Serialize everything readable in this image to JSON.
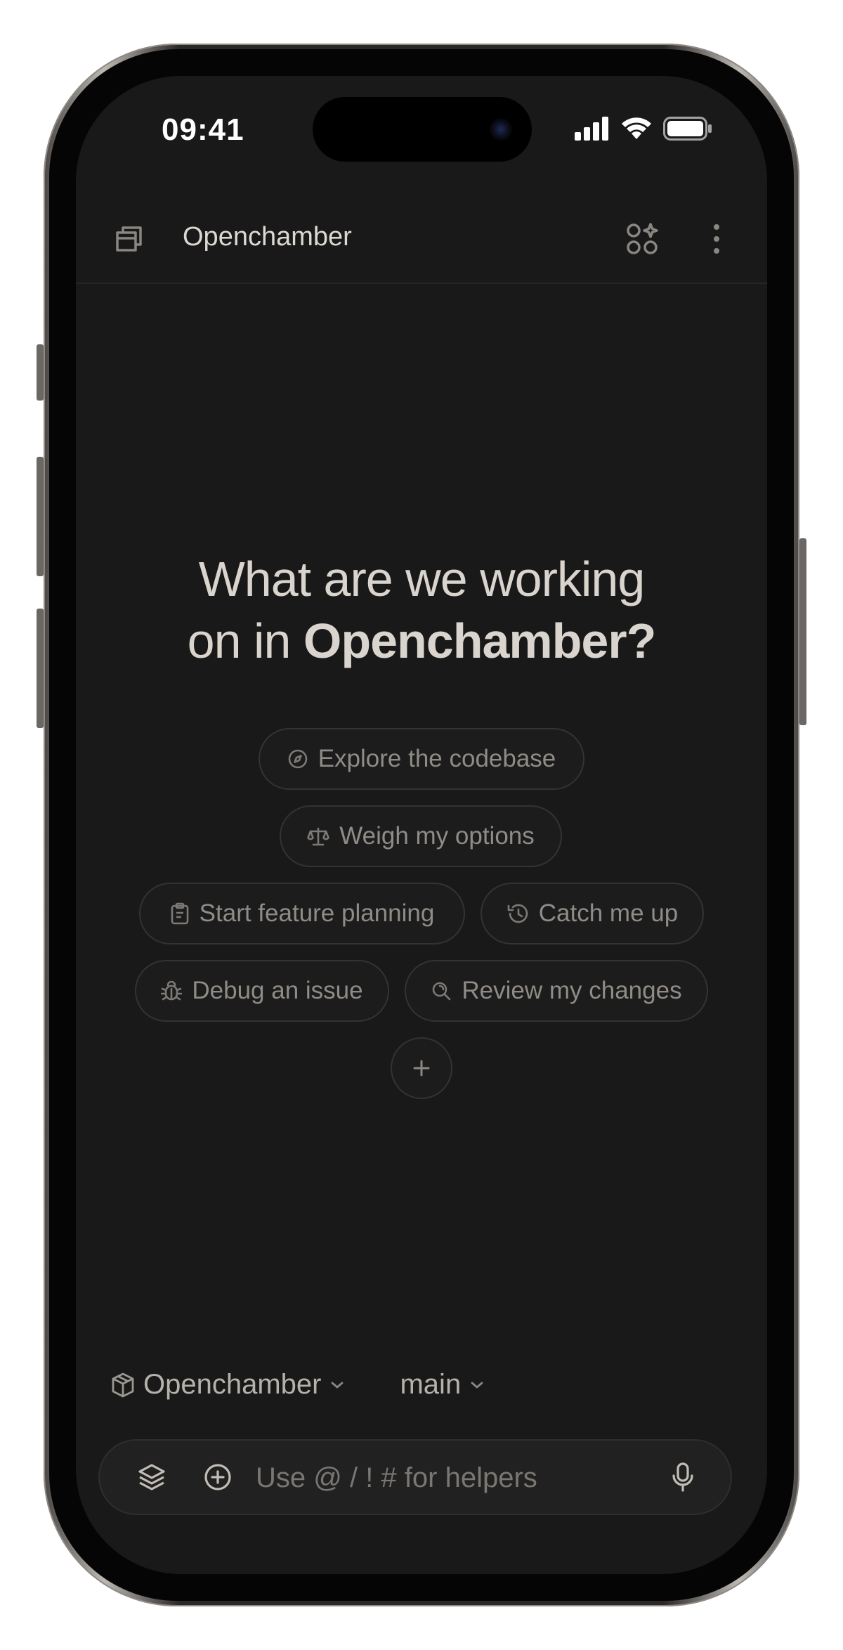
{
  "status_bar": {
    "time": "09:41"
  },
  "header": {
    "title": "Openchamber"
  },
  "hero": {
    "line1": "What are we working",
    "line2_prefix": "on in ",
    "project": "Openchamber",
    "suffix": "?"
  },
  "suggestions": [
    {
      "label": "Explore the codebase",
      "icon": "compass-icon"
    },
    {
      "label": "Weigh my options",
      "icon": "scale-icon"
    },
    {
      "label": "Start feature planning",
      "icon": "clipboard-icon"
    },
    {
      "label": "Catch me up",
      "icon": "history-icon"
    },
    {
      "label": "Debug an issue",
      "icon": "bug-icon"
    },
    {
      "label": "Review my changes",
      "icon": "search-icon"
    }
  ],
  "context": {
    "project": "Openchamber",
    "branch": "main"
  },
  "composer": {
    "placeholder": "Use @ / ! # for helpers"
  },
  "colors": {
    "background": "#1a1919",
    "text": "#d9d4cd",
    "chip_border": "#343232",
    "chip_text": "#8f8b86"
  }
}
